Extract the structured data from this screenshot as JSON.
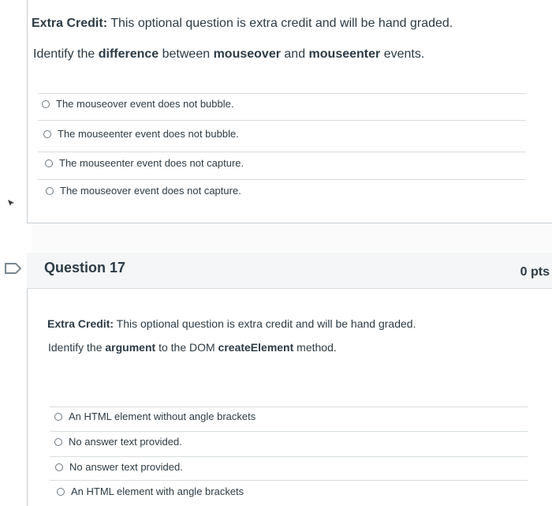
{
  "question16": {
    "extra_credit_label": "Extra Credit:",
    "extra_credit_text": " This optional question is extra credit and will be hand graded.",
    "prompt_prefix": "Identify the ",
    "prompt_bold1": "difference",
    "prompt_mid1": " between ",
    "prompt_bold2": "mouseover",
    "prompt_mid2": " and ",
    "prompt_bold3": "mouseenter",
    "prompt_suffix": " events.",
    "answers": [
      "The mouseover event does not bubble.",
      "The mouseenter event does not bubble.",
      "The mouseenter event does not capture.",
      "The mouseover event does not capture."
    ]
  },
  "question17": {
    "title": "Question 17",
    "points": "0 pts",
    "extra_credit_label": "Extra Credit:",
    "extra_credit_text": " This optional question is extra credit and will be hand graded.",
    "prompt_prefix": "Identify the ",
    "prompt_bold1": "argument",
    "prompt_mid1": " to the DOM ",
    "prompt_bold2": "createElement",
    "prompt_suffix": " method.",
    "answers": [
      "An HTML element without angle brackets",
      "No answer text provided.",
      "No answer text provided.",
      "An HTML element with angle brackets"
    ]
  },
  "icons": {
    "flag": "flag-icon",
    "cursor": "cursor-arrow-icon",
    "radio": "radio-button-icon"
  }
}
